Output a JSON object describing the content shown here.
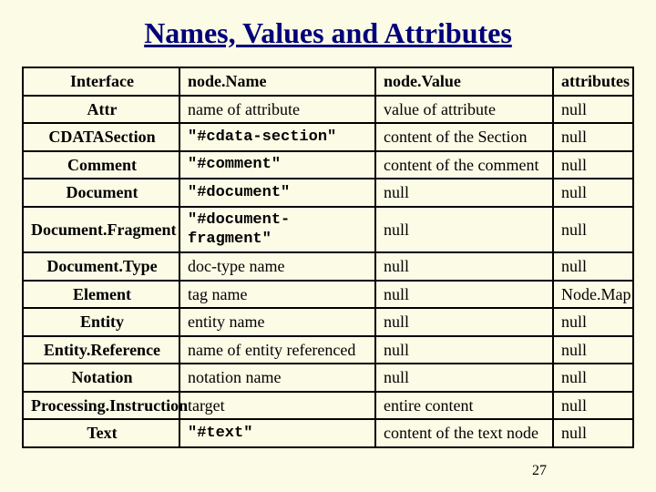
{
  "title": "Names, Values and Attributes",
  "page_number": "27",
  "headers": {
    "interface": "Interface",
    "nodeName": "node.Name",
    "nodeValue": "node.Value",
    "attributes": "attributes"
  },
  "rows": [
    {
      "interface": "Attr",
      "nodeName": "name of attribute",
      "mono": false,
      "nodeValue": "value of attribute",
      "attributes": "null"
    },
    {
      "interface": "CDATASection",
      "nodeName": "\"#cdata-section\"",
      "mono": true,
      "nodeValue": "content of the Section",
      "attributes": "null"
    },
    {
      "interface": "Comment",
      "nodeName": "\"#comment\"",
      "mono": true,
      "nodeValue": "content of the comment",
      "attributes": "null"
    },
    {
      "interface": "Document",
      "nodeName": "\"#document\"",
      "mono": true,
      "nodeValue": "null",
      "attributes": "null"
    },
    {
      "interface": "Document.Fragment",
      "nodeName": "\"#document-fragment\"",
      "mono": true,
      "nodeValue": "null",
      "attributes": "null"
    },
    {
      "interface": "Document.Type",
      "nodeName": "doc-type name",
      "mono": false,
      "nodeValue": "null",
      "attributes": "null"
    },
    {
      "interface": "Element",
      "nodeName": "tag name",
      "mono": false,
      "nodeValue": "null",
      "attributes": "Node.Map"
    },
    {
      "interface": "Entity",
      "nodeName": "entity name",
      "mono": false,
      "nodeValue": "null",
      "attributes": "null"
    },
    {
      "interface": "Entity.Reference",
      "nodeName": "name of entity referenced",
      "mono": false,
      "nodeValue": "null",
      "attributes": "null"
    },
    {
      "interface": "Notation",
      "nodeName": "notation name",
      "mono": false,
      "nodeValue": "null",
      "attributes": "null"
    },
    {
      "interface": "Processing.Instruction",
      "nodeName": "target",
      "mono": false,
      "nodeValue": "entire content",
      "attributes": "null"
    },
    {
      "interface": "Text",
      "nodeName": "\"#text\"",
      "mono": true,
      "nodeValue": "content of the text node",
      "attributes": "null"
    }
  ]
}
